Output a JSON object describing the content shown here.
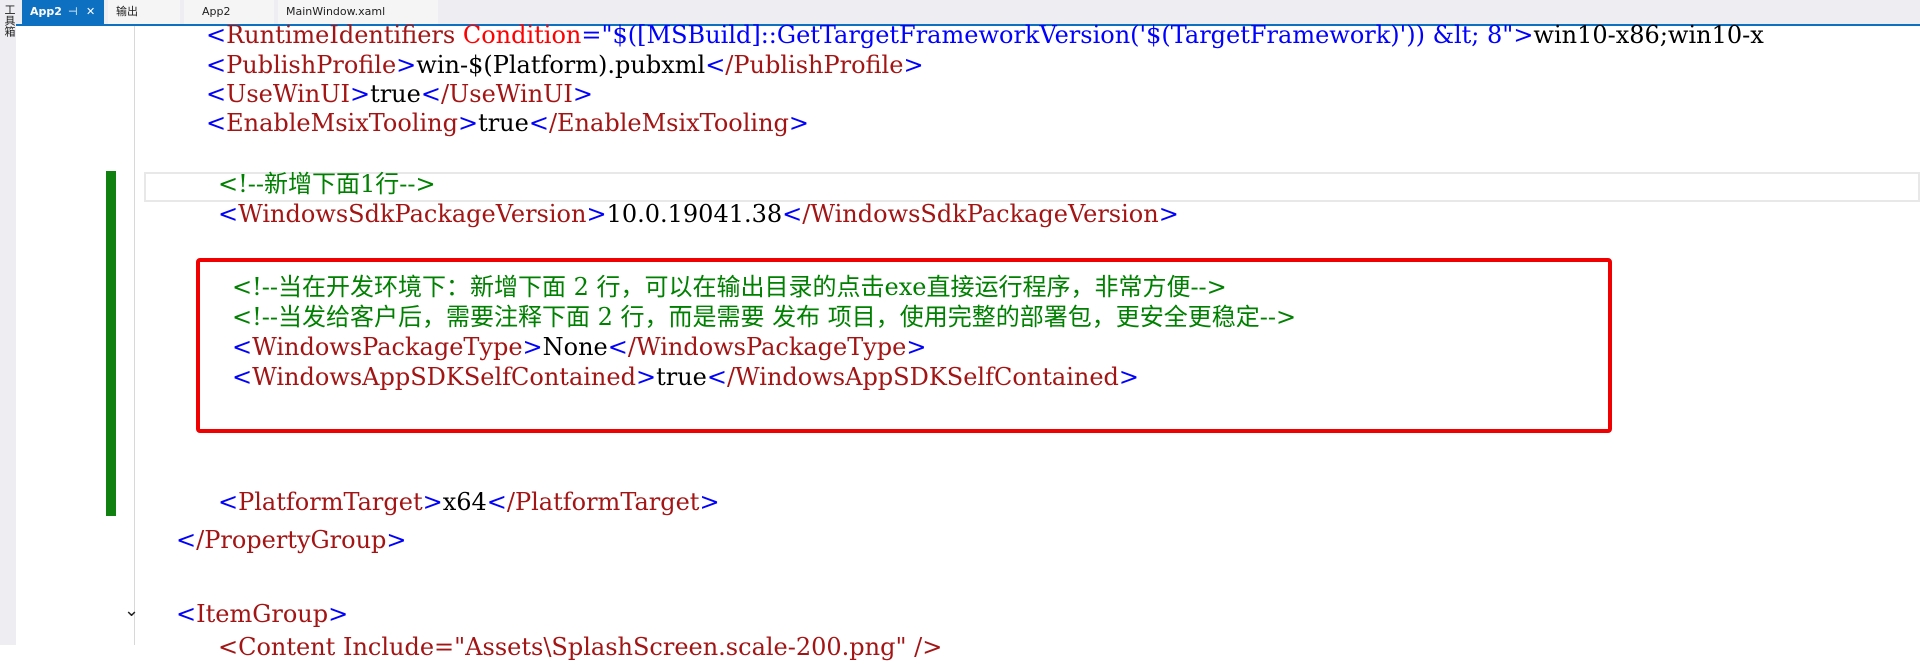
{
  "toolbox": {
    "label": "工具箱"
  },
  "tabs": {
    "app2_active": "App2",
    "app2_pin": "⊣",
    "app2_close": "✕",
    "output": "输出",
    "app2": "App2",
    "mainwindow": "MainWindow.xaml"
  },
  "code": {
    "l1": {
      "tag": "RuntimeIdentifiers",
      "attr": "Condition",
      "val": "\"$([MSBuild]::GetTargetFrameworkVersion('$(TargetFramework)')) &lt; 8\"",
      "text": "win10-x86;win10-x"
    },
    "l2": {
      "tag": "PublishProfile",
      "text": "win-$(Platform).pubxml",
      "close": "/PublishProfile"
    },
    "l3": {
      "tag": "UseWinUI",
      "text": "true",
      "close": "/UseWinUI"
    },
    "l4": {
      "tag": "EnableMsixTooling",
      "text": "true",
      "close": "/EnableMsixTooling"
    },
    "l5": {
      "comment": "<!--新增下面1行-->"
    },
    "l6": {
      "tag": "WindowsSdkPackageVersion",
      "text": "10.0.19041.38",
      "close": "/WindowsSdkPackageVersion"
    },
    "l7": {
      "comment": "<!--当在开发环境下：新增下面 2 行，可以在输出目录的点击exe直接运行程序，非常方便-->"
    },
    "l8": {
      "comment": "<!--当发给客户后，需要注释下面 2 行，而是需要 发布 项目，使用完整的部署包，更安全更稳定-->"
    },
    "l9": {
      "tag": "WindowsPackageType",
      "text": "None",
      "close": "/WindowsPackageType"
    },
    "l10": {
      "tag": "WindowsAppSDKSelfContained",
      "text": "true",
      "close": "/WindowsAppSDKSelfContained"
    },
    "l11": {
      "tag": "PlatformTarget",
      "text": "x64",
      "close": "/PlatformTarget"
    },
    "l12": {
      "close": "/PropertyGroup"
    },
    "l13": {
      "tag": "ItemGroup"
    },
    "l14": {
      "partial": "<Content Include=\"Assets\\SplashScreen.scale-200.png\" />"
    }
  },
  "icons": {
    "fold": "chevron-down-icon"
  },
  "colors": {
    "tag": "#a31515",
    "bracket": "#0000ff",
    "attribute": "#ff0000",
    "comment": "#008000",
    "highlight": "#f00000",
    "change_bar": "#108010",
    "tab_active": "#0e70c0"
  }
}
